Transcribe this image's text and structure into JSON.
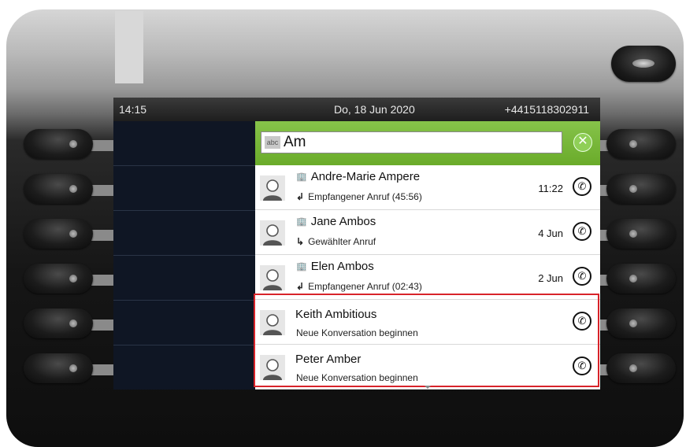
{
  "status_bar": {
    "time": "14:15",
    "date": "Do, 18 Jun 2020",
    "phone_number": "+4415118302911"
  },
  "search": {
    "mode_badge": "abc",
    "value": "Am",
    "clear_icon": "close-icon",
    "accent_color": "#7ab83a"
  },
  "contacts": [
    {
      "name": "Andre-Marie Ampere",
      "detail": "Empfangener Anruf (45:56)",
      "time": "11:22",
      "type": "incoming-call-icon",
      "badge": "building-icon"
    },
    {
      "name": "Jane Ambos",
      "detail": "Gewählter Anruf",
      "time": "4 Jun",
      "type": "outgoing-call-icon",
      "badge": "building-icon"
    },
    {
      "name": "Elen Ambos",
      "detail": "Empfangener Anruf (02:43)",
      "time": "2 Jun",
      "type": "incoming-call-icon",
      "badge": "building-icon"
    },
    {
      "name": "Keith Ambitious",
      "detail": "Neue Konversation beginnen",
      "time": "",
      "type": "",
      "badge": ""
    },
    {
      "name": "Peter Amber",
      "detail": "Neue Konversation beginnen",
      "time": "",
      "type": "",
      "badge": ""
    }
  ],
  "highlight_color": "#d8232a"
}
